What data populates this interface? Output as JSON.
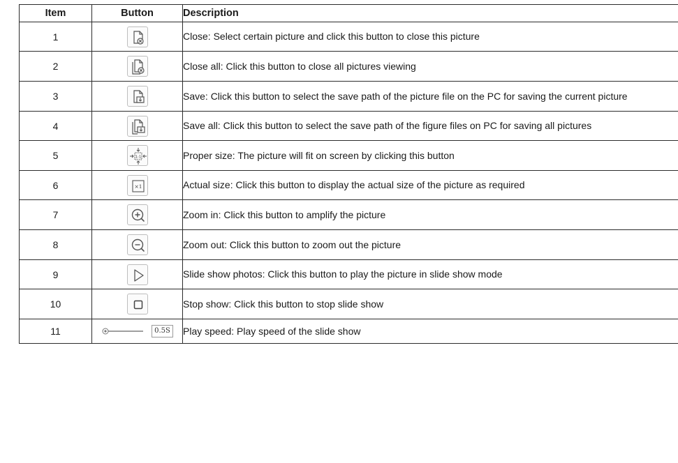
{
  "table": {
    "headers": {
      "item": "Item",
      "button": "Button",
      "description": "Description"
    },
    "rows": [
      {
        "item": "1",
        "icon": "close-picture-icon",
        "description": "Close: Select certain picture and click this button to close this picture"
      },
      {
        "item": "2",
        "icon": "close-all-pictures-icon",
        "description": "Close all: Click this button to close all pictures viewing"
      },
      {
        "item": "3",
        "icon": "save-picture-icon",
        "description": "Save: Click this button to select the save path of the picture file on the PC for saving the current picture"
      },
      {
        "item": "4",
        "icon": "save-all-pictures-icon",
        "description": "Save all: Click this button to select the save path of the figure files on PC for saving all pictures"
      },
      {
        "item": "5",
        "icon": "proper-size-icon",
        "icon_text": "1:1",
        "description": "Proper size: The picture will fit on screen by clicking this button"
      },
      {
        "item": "6",
        "icon": "actual-size-icon",
        "icon_text": "×1",
        "description": "Actual size: Click this button to display the actual size of the picture as required"
      },
      {
        "item": "7",
        "icon": "zoom-in-icon",
        "description": "Zoom in: Click this button to amplify the picture"
      },
      {
        "item": "8",
        "icon": "zoom-out-icon",
        "description": "Zoom out: Click this button to zoom out the picture"
      },
      {
        "item": "9",
        "icon": "play-slideshow-icon",
        "description": "Slide show photos: Click this button to play the picture in slide show mode"
      },
      {
        "item": "10",
        "icon": "stop-slideshow-icon",
        "description": "Stop show: Click this button to stop slide show"
      },
      {
        "item": "11",
        "icon": "play-speed-slider-icon",
        "speed_value": "0.5S",
        "slider_level": 0,
        "description": "Play speed: Play speed of the slide show"
      }
    ]
  }
}
